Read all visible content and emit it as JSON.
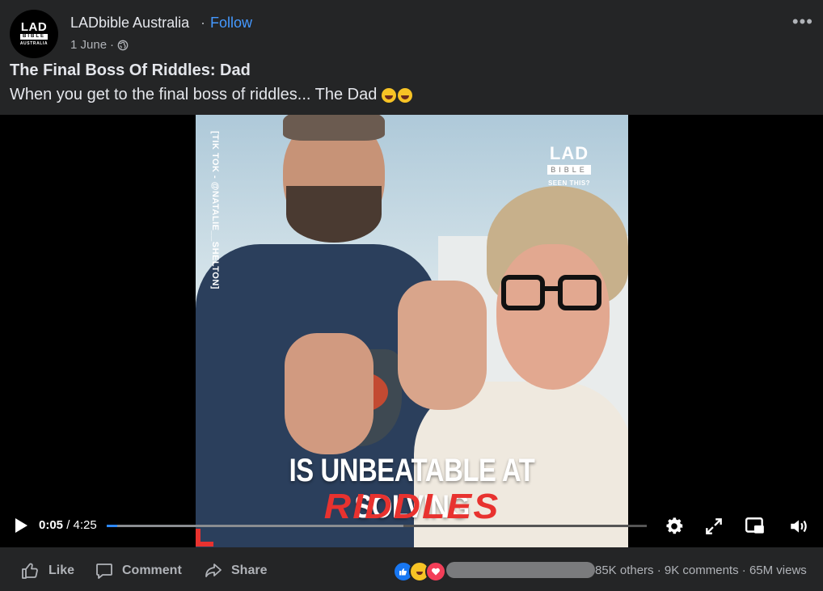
{
  "post": {
    "page_name": "LADbible Australia",
    "separator": "·",
    "follow_label": "Follow",
    "date": "1 June",
    "meta_separator": "·",
    "privacy_icon": "globe-icon",
    "more_icon": "more-options-icon",
    "more_label": "•••",
    "title": "The Final Boss Of Riddles: Dad",
    "description": "When you get to the final boss of riddles... The Dad",
    "description_emojis": [
      "laughing-crying-emoji",
      "laughing-crying-emoji"
    ]
  },
  "avatar": {
    "line1": "LAD",
    "line2": "BIBLE",
    "line3": "AUSTRALIA"
  },
  "video": {
    "watermark": "[TIK TOK - @NATALIE__SHELTON]",
    "brand_line1": "LAD",
    "brand_line2": "BIBLE",
    "brand_line3": "SEEN THIS?",
    "caption_line1": "IS UNBEATABLE AT SOLVING",
    "caption_line2": "RIDDLES",
    "caption_color": "#e8322f"
  },
  "player": {
    "current_time": "0:05",
    "time_separator": " / ",
    "duration": "4:25",
    "played_fraction": 0.02,
    "buffered_fraction": 0.55,
    "icons": [
      "play-icon",
      "settings-icon",
      "fullscreen-icon",
      "picture-in-picture-icon",
      "volume-icon"
    ],
    "accent": "#2d88ff"
  },
  "actions": {
    "like_label": "Like",
    "comment_label": "Comment",
    "share_label": "Share"
  },
  "engagement": {
    "reactions": [
      "like-reaction-icon",
      "haha-reaction-icon",
      "love-reaction-icon"
    ],
    "others": "85K others",
    "separator": "·",
    "comments": "9K comments",
    "views": "65M views"
  }
}
